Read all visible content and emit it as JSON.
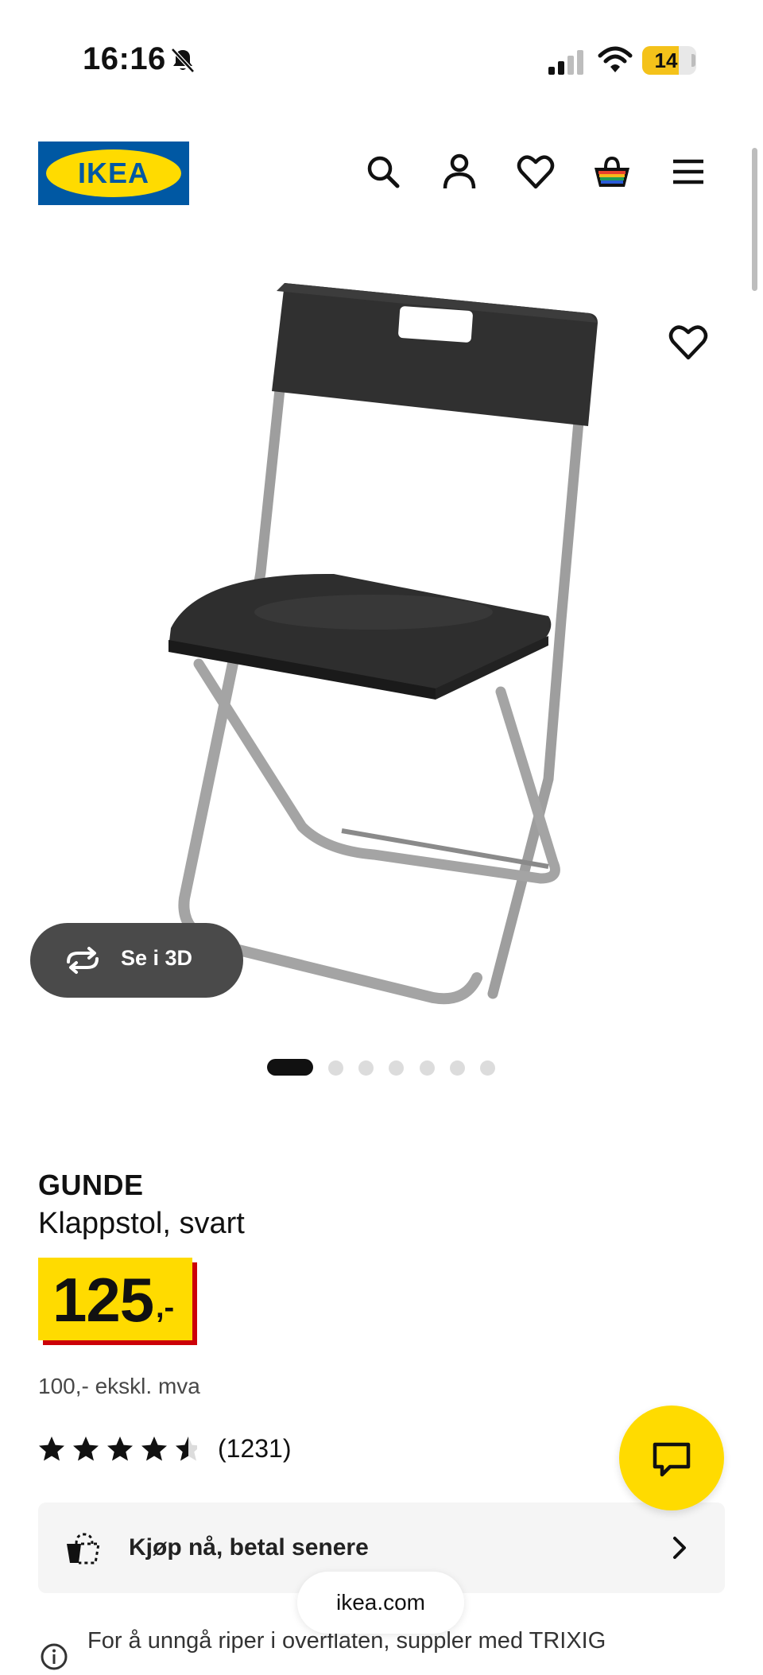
{
  "status_bar": {
    "time": "16:16",
    "battery": "14",
    "icons": [
      "bell-muted-icon",
      "cellular-signal-icon",
      "wifi-icon",
      "battery-icon"
    ]
  },
  "header": {
    "logo_text": "IKEA",
    "icons": [
      "search-icon",
      "account-icon",
      "wishlist-heart-icon",
      "shopping-bag-icon",
      "menu-icon"
    ]
  },
  "gallery": {
    "see_3d_label": "Se i 3D",
    "dot_count": 7,
    "active_index": 0
  },
  "product": {
    "name": "GUNDE",
    "description": "Klappstol, svart",
    "price_whole": "125",
    "price_suffix": ",-",
    "price_ex_vat": "100,- ekskl. mva",
    "rating": 4.5,
    "rating_count": "(1231)"
  },
  "bnpl": {
    "label": "Kjøp nå, betal senere"
  },
  "browser": {
    "url": "ikea.com"
  },
  "note": {
    "text": "For å unngå riper i overflaten, suppler med TRIXIG"
  },
  "colors": {
    "ikea_blue": "#0058a3",
    "ikea_yellow": "#ffdb00",
    "price_red": "#cc0008"
  }
}
